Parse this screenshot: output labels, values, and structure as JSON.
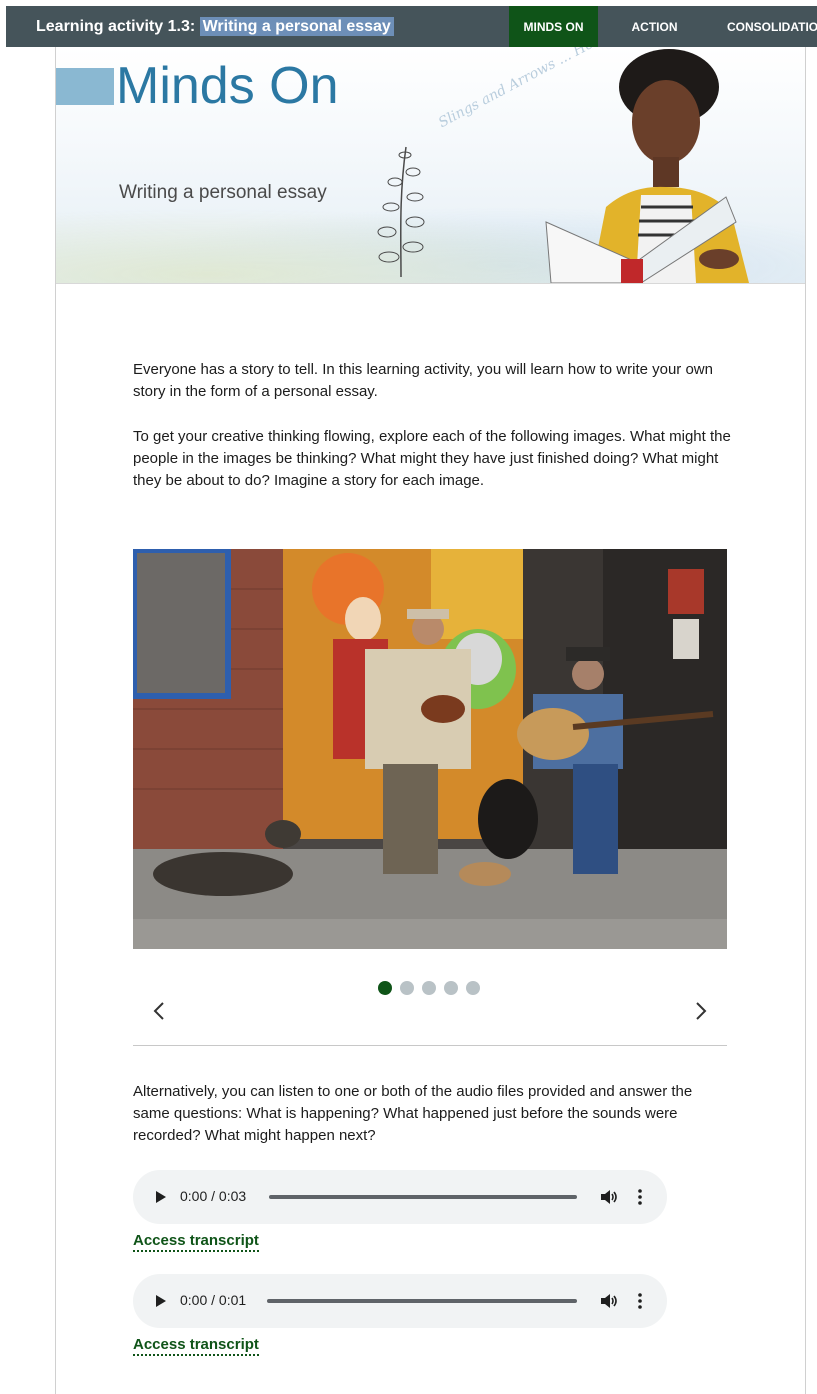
{
  "header": {
    "title_prefix": "Learning activity 1.3: ",
    "title_highlight": "Writing a personal essay",
    "tabs": [
      {
        "label": "MINDS ON",
        "active": true
      },
      {
        "label": "ACTION",
        "active": false
      },
      {
        "label": "CONSOLIDATION",
        "active": false
      }
    ]
  },
  "banner": {
    "heading": "Minds On",
    "subheading": "Writing a personal essay",
    "script_text": "Slings and Arrows ... Holden ... here comes the"
  },
  "intro": {
    "p1": "Everyone has a story to tell. In this learning activity, you will learn how to write your own story in the form of a personal essay.",
    "p2": "To get your creative thinking flowing, explore each of the following images. What might the people in the images be thinking? What might they have just finished doing? What might they be about to do? Imagine a story for each image."
  },
  "carousel": {
    "slide_count": 5,
    "active_index": 0
  },
  "audio_intro": "Alternatively, you can listen to one or both of the audio files provided and answer the same questions: What is happening? What happened just before the sounds were recorded? What might happen next?",
  "audio": [
    {
      "time": "0:00 / 0:03",
      "transcript_label": "Access transcript"
    },
    {
      "time": "0:00 / 0:01",
      "transcript_label": "Access transcript"
    }
  ],
  "colors": {
    "topbar": "#45545a",
    "active_tab": "#0f5418",
    "heading_blue": "#2b78a3",
    "link_green": "#0f5418"
  }
}
